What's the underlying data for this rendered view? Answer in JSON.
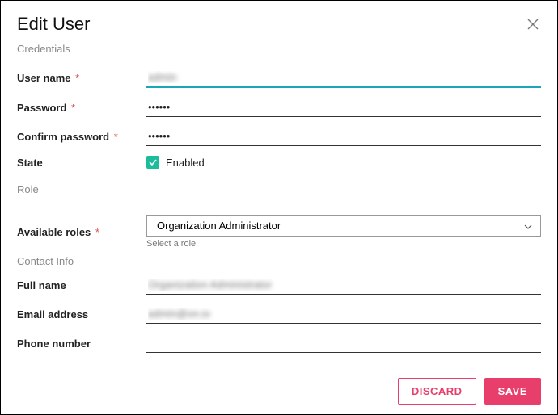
{
  "title": "Edit User",
  "sections": {
    "credentials": "Credentials",
    "role": "Role",
    "contact": "Contact Info"
  },
  "fields": {
    "username": {
      "label": "User name",
      "value": "admin",
      "required": true
    },
    "password": {
      "label": "Password",
      "value": "••••••",
      "required": true
    },
    "confirm": {
      "label": "Confirm password",
      "value": "••••••",
      "required": true
    },
    "state": {
      "label": "State",
      "checked": true,
      "checkbox_label": "Enabled"
    },
    "roles": {
      "label": "Available roles",
      "selected": "Organization Administrator",
      "required": true,
      "helper": "Select a role"
    },
    "fullname": {
      "label": "Full name",
      "value": "Organization Administrator"
    },
    "email": {
      "label": "Email address",
      "value": "admin@on.io"
    },
    "phone": {
      "label": "Phone number",
      "value": ""
    }
  },
  "buttons": {
    "discard": "DISCARD",
    "save": "SAVE"
  },
  "required_marker": "*"
}
